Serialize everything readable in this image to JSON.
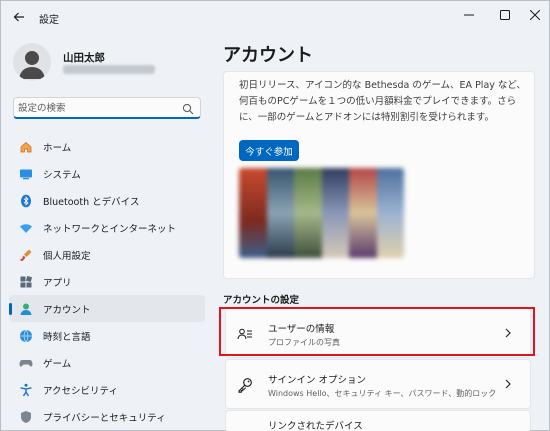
{
  "window": {
    "title": "設定"
  },
  "profile": {
    "name": "山田太郎"
  },
  "search": {
    "placeholder": "設定の検索"
  },
  "sidebar": {
    "items": [
      {
        "label": "ホーム",
        "icon": "home-icon"
      },
      {
        "label": "システム",
        "icon": "system-icon"
      },
      {
        "label": "Bluetooth とデバイス",
        "icon": "bluetooth-icon"
      },
      {
        "label": "ネットワークとインターネット",
        "icon": "wifi-icon"
      },
      {
        "label": "個人用設定",
        "icon": "brush-icon"
      },
      {
        "label": "アプリ",
        "icon": "apps-icon"
      },
      {
        "label": "アカウント",
        "icon": "account-icon",
        "active": true
      },
      {
        "label": "時刻と言語",
        "icon": "globe-icon"
      },
      {
        "label": "ゲーム",
        "icon": "gamepad-icon"
      },
      {
        "label": "アクセシビリティ",
        "icon": "accessibility-icon"
      },
      {
        "label": "プライバシーとセキュリティ",
        "icon": "shield-icon"
      }
    ]
  },
  "main": {
    "title": "アカウント",
    "promo": {
      "text": "初日リリース、アイコン的な Bethesda のゲーム、EA Play など、何百ものPCゲームを１つの低い月額料金でプレイできます。さらに、一部のゲームとアドオンには特別割引を受けられます。",
      "button": "今すぐ参加"
    },
    "section_title": "アカウントの設定",
    "rows": [
      {
        "title": "ユーザーの情報",
        "subtitle": "プロファイルの写真",
        "icon": "user-info-icon"
      },
      {
        "title": "サインイン オプション",
        "subtitle": "Windows Hello、セキュリティ キー、パスワード、動的ロック",
        "icon": "key-icon"
      },
      {
        "title": "リンクされたデバイス",
        "subtitle": "",
        "icon": "devices-icon"
      }
    ]
  },
  "colors": {
    "accent": "#0067c0",
    "highlight": "#e0141e",
    "background": "#eef2f7"
  }
}
